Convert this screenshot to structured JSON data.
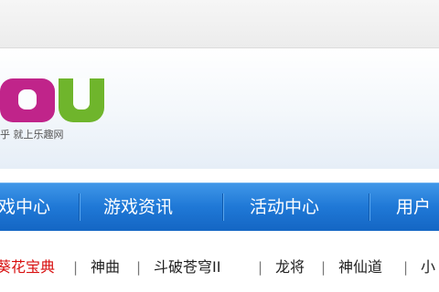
{
  "header": {
    "tagline": "乎 就上乐趣网"
  },
  "nav": {
    "items": [
      {
        "label": "戏中心"
      },
      {
        "label": "游戏资讯"
      },
      {
        "label": "活动中心"
      },
      {
        "label": "用户"
      }
    ]
  },
  "subnav": {
    "items": [
      {
        "label": "葵花宝典",
        "hot": true
      },
      {
        "label": "神曲"
      },
      {
        "label": "斗破苍穹II"
      },
      {
        "label": "龙将"
      },
      {
        "label": "神仙道"
      },
      {
        "label": "小"
      }
    ],
    "separator": "|"
  },
  "colors": {
    "logo_magenta": "#c0248a",
    "logo_green": "#6fb52c",
    "nav_blue": "#1f78d6",
    "hot_red": "#d81010"
  }
}
